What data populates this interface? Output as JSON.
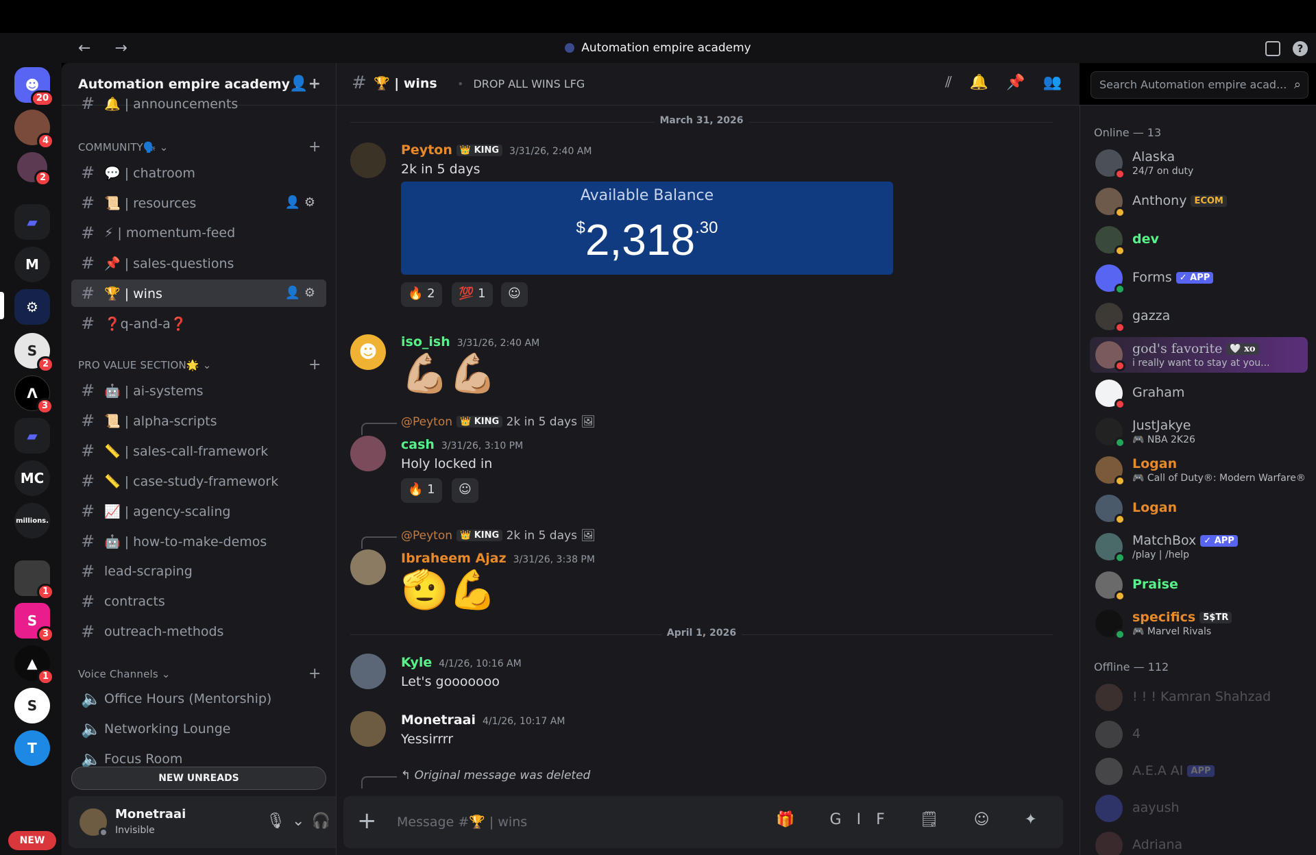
{
  "window": {
    "title": "Automation empire academy",
    "nav": "← →"
  },
  "rail": {
    "badges": [
      "20",
      "4",
      "2",
      "2",
      "3",
      "1",
      "3",
      "1"
    ],
    "letters": [
      "M",
      "MC"
    ],
    "new_label": "NEW",
    "millions": "millions."
  },
  "guild": {
    "name": "Automation empire academy"
  },
  "categories": {
    "community": "COMMUNITY🗣️",
    "pro": "PRO VALUE SECTION🌟",
    "voice": "Voice Channels"
  },
  "channels": {
    "top": "🔔 | announcements",
    "community": [
      "💬 | chatroom",
      "📜 | resources",
      "⚡ | momentum-feed",
      "📌 | sales-questions",
      "🏆 | wins",
      "❓q-and-a❓"
    ],
    "pro": [
      "🤖 | ai-systems",
      "📜 | alpha-scripts",
      "📏 | sales-call-framework",
      "📏 | case-study-framework",
      "📈 | agency-scaling",
      "🤖 | how-to-make-demos",
      "lead-scraping",
      "contracts",
      "outreach-methods"
    ],
    "voice": [
      "Office Hours (Mentorship)",
      "Networking Lounge",
      "Focus Room"
    ]
  },
  "new_unreads": "NEW UNREADS",
  "user": {
    "name": "Monetraai",
    "status": "Invisible"
  },
  "header": {
    "channel": "🏆 | wins",
    "topic": "DROP ALL WINS LFG",
    "search_placeholder": "Search Automation empire acad..."
  },
  "messages": {
    "date1": "March 31, 2026",
    "date2": "April 1, 2026",
    "m1": {
      "author": "Peyton",
      "tag": "👑 KING",
      "time": "3/31/26, 2:40 AM",
      "text": "2k in 5 days",
      "balance_label": "Available Balance",
      "balance_dollars": "2,318",
      "balance_cents": ".30",
      "balance_sym": "$",
      "r1": "🔥 2",
      "r2": "💯 1",
      "r3": "☺"
    },
    "m2": {
      "author": "iso_ish",
      "time": "3/31/26, 2:40 AM",
      "emoji": "💪🏼💪🏼"
    },
    "m3": {
      "reply": "@Peyton",
      "reply_tag": "👑 KING",
      "reply_text": "2k in 5 days",
      "author": "cash",
      "time": "3/31/26, 3:10 PM",
      "text": "Holy locked in",
      "r1": "🔥 1",
      "r2": "☺"
    },
    "m4": {
      "reply": "@Peyton",
      "reply_tag": "👑 KING",
      "reply_text": "2k in 5 days",
      "author": "Ibraheem Ajaz",
      "time": "3/31/26, 3:38 PM",
      "emoji": "🫡💪"
    },
    "m5": {
      "author": "Kyle",
      "time": "4/1/26, 10:16 AM",
      "text": "Let's gooooooo"
    },
    "m6": {
      "author": "Monetraai",
      "time": "4/1/26, 10:17 AM",
      "text": "Yessirrrr"
    },
    "m7": {
      "reply_text": "Original message was deleted"
    }
  },
  "composer": {
    "placeholder": "Message #🏆 | wins",
    "controls": "🎁 GIF 🗒 ☺ ✦"
  },
  "members": {
    "online_header": "Online — 13",
    "offline_header": "Offline — 112",
    "online": [
      {
        "name": "Alaska",
        "sub": "24/7 on duty"
      },
      {
        "name": "Anthony",
        "badge": "ECOM"
      },
      {
        "name": "dev"
      },
      {
        "name": "Forms",
        "badge": "✓ APP"
      },
      {
        "name": "gazza"
      },
      {
        "name": "god's favorite",
        "badge": "🤍 xo",
        "sub": "i really want to stay at you..."
      },
      {
        "name": "Graham"
      },
      {
        "name": "JustJakye",
        "sub": "🎮 NBA 2K26"
      },
      {
        "name": "Logan",
        "sub": "🎮 Call of Duty®: Modern Warfare®"
      },
      {
        "name": "Logan"
      },
      {
        "name": "MatchBox",
        "badge": "✓ APP",
        "sub": "/play | /help"
      },
      {
        "name": "Praise"
      },
      {
        "name": "specifics",
        "badge": "5$TR",
        "sub": "🎮 Marvel Rivals"
      }
    ],
    "offline": [
      {
        "name": "! ! ! Kamran Shahzad"
      },
      {
        "name": "4"
      },
      {
        "name": "A.E.A AI",
        "badge": "APP"
      },
      {
        "name": "aayush"
      },
      {
        "name": "Adriana"
      }
    ]
  },
  "colors": {
    "orange": "#e8892b",
    "green": "#57f287",
    "blurple": "#5865f2",
    "red": "#f23f43"
  }
}
